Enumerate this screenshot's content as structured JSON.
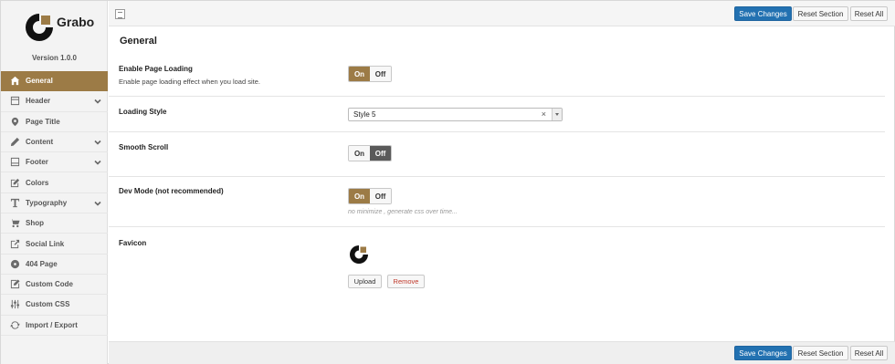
{
  "brand": {
    "name": "Grabo",
    "version": "Version 1.0.0"
  },
  "colors": {
    "accent": "#9c7b46",
    "primary_button": "#2271b1",
    "sidebar_bg": "#f3f3f3"
  },
  "sidebar": {
    "items": [
      {
        "label": "General",
        "icon": "home-icon",
        "active": true,
        "expandable": false
      },
      {
        "label": "Header",
        "icon": "header-icon",
        "active": false,
        "expandable": true
      },
      {
        "label": "Page Title",
        "icon": "map-pin-icon",
        "active": false,
        "expandable": false
      },
      {
        "label": "Content",
        "icon": "pencil-icon",
        "active": false,
        "expandable": true
      },
      {
        "label": "Footer",
        "icon": "footer-icon",
        "active": false,
        "expandable": true
      },
      {
        "label": "Colors",
        "icon": "edit-icon",
        "active": false,
        "expandable": false
      },
      {
        "label": "Typography",
        "icon": "text-icon",
        "active": false,
        "expandable": true
      },
      {
        "label": "Shop",
        "icon": "cart-icon",
        "active": false,
        "expandable": false
      },
      {
        "label": "Social Link",
        "icon": "share-icon",
        "active": false,
        "expandable": false
      },
      {
        "label": "404 Page",
        "icon": "disc-icon",
        "active": false,
        "expandable": false
      },
      {
        "label": "Custom Code",
        "icon": "code-edit-icon",
        "active": false,
        "expandable": false
      },
      {
        "label": "Custom CSS",
        "icon": "sliders-icon",
        "active": false,
        "expandable": false
      },
      {
        "label": "Import / Export",
        "icon": "refresh-icon",
        "active": false,
        "expandable": false
      }
    ]
  },
  "toolbar": {
    "save_label": "Save Changes",
    "reset_section_label": "Reset Section",
    "reset_all_label": "Reset All"
  },
  "main": {
    "title": "General",
    "settings": {
      "page_loading": {
        "label": "Enable Page Loading",
        "description": "Enable page loading effect when you load site.",
        "on_label": "On",
        "off_label": "Off",
        "value": "On"
      },
      "loading_style": {
        "label": "Loading Style",
        "value": "Style 5",
        "clear": "×"
      },
      "smooth_scroll": {
        "label": "Smooth Scroll",
        "on_label": "On",
        "off_label": "Off",
        "value": "Off"
      },
      "dev_mode": {
        "label": "Dev Mode (not recommended)",
        "hint": "no minimize , generate css over time...",
        "on_label": "On",
        "off_label": "Off",
        "value": "On"
      },
      "favicon": {
        "label": "Favicon",
        "upload_label": "Upload",
        "remove_label": "Remove"
      }
    }
  }
}
